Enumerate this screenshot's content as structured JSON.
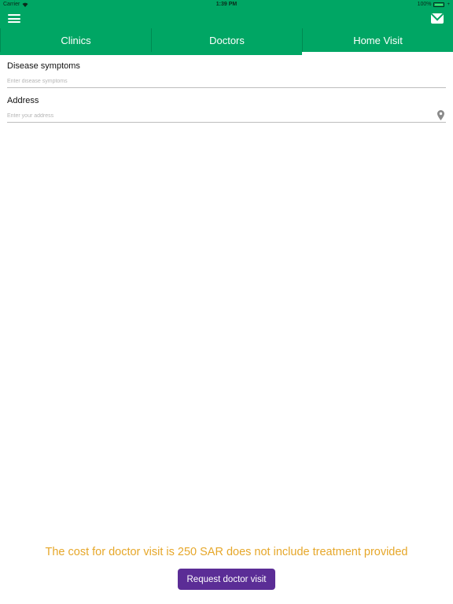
{
  "status_bar": {
    "carrier": "Carrier",
    "time": "1:39 PM",
    "battery": "100%"
  },
  "header": {
    "menu_icon": "hamburger-menu-icon",
    "mail_icon": "envelope-icon"
  },
  "tabs": [
    {
      "label": "Clinics",
      "active": false
    },
    {
      "label": "Doctors",
      "active": false
    },
    {
      "label": "Home Visit",
      "active": true
    }
  ],
  "form": {
    "symptoms": {
      "label": "Disease symptoms",
      "placeholder": "Enter disease symptoms",
      "value": ""
    },
    "address": {
      "label": "Address",
      "placeholder": "Enter your address",
      "value": "",
      "icon": "location-pin-icon"
    }
  },
  "footer": {
    "cost_note": "The cost for doctor visit is 250 SAR does not include treatment provided",
    "request_button": "Request doctor visit"
  },
  "colors": {
    "primary": "#00a664",
    "accent_text": "#e6a72a",
    "button": "#5b2d96"
  }
}
